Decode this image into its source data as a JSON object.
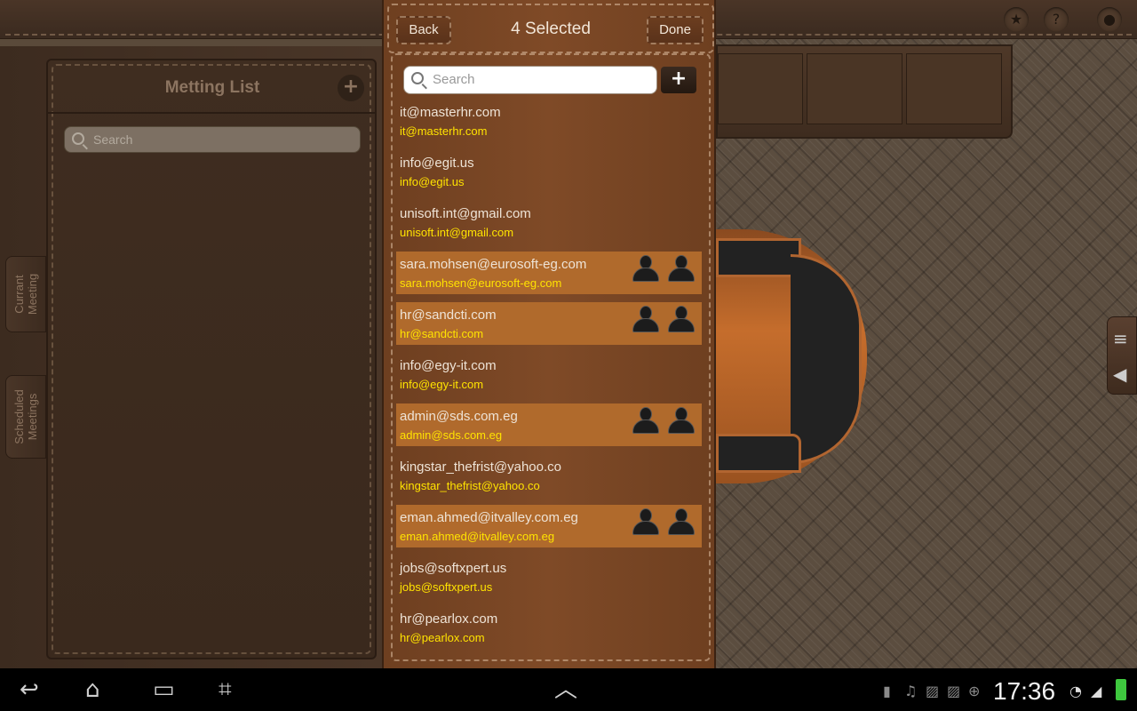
{
  "popup": {
    "title": "4 Selected",
    "back_label": "Back",
    "done_label": "Done",
    "search_placeholder": "Search",
    "add_label": "+",
    "contacts": [
      {
        "name": "it@masterhr.com",
        "email": "it@masterhr.com",
        "selected": false
      },
      {
        "name": "info@egit.us",
        "email": "info@egit.us",
        "selected": false
      },
      {
        "name": "unisoft.int@gmail.com",
        "email": "unisoft.int@gmail.com",
        "selected": false
      },
      {
        "name": "sara.mohsen@eurosoft-eg.com",
        "email": "sara.mohsen@eurosoft-eg.com",
        "selected": true
      },
      {
        "name": "hr@sandcti.com",
        "email": "hr@sandcti.com",
        "selected": true
      },
      {
        "name": "info@egy-it.com",
        "email": "info@egy-it.com",
        "selected": false
      },
      {
        "name": "admin@sds.com.eg",
        "email": "admin@sds.com.eg",
        "selected": true
      },
      {
        "name": "kingstar_thefrist@yahoo.co",
        "email": "kingstar_thefrist@yahoo.co",
        "selected": false
      },
      {
        "name": "eman.ahmed@itvalley.com.eg",
        "email": "eman.ahmed@itvalley.com.eg",
        "selected": true
      },
      {
        "name": "jobs@softxpert.us",
        "email": "jobs@softxpert.us",
        "selected": false
      },
      {
        "name": "hr@pearlox.com",
        "email": "hr@pearlox.com",
        "selected": false
      }
    ]
  },
  "left_panel": {
    "title": "Metting List",
    "add_label": "+",
    "search_placeholder": "Search"
  },
  "side_tabs": {
    "current": "Currant\nMeeting",
    "scheduled": "Scheduled\nMeetings"
  },
  "top_icons": [
    "star-icon",
    "help-icon",
    "user-icon"
  ],
  "right_tab_icons": [
    "menu-icon",
    "back-arrow-icon"
  ],
  "status_bar": {
    "time": "17:36"
  },
  "colors": {
    "selected_row": "#b06a2c",
    "email_text": "#ffe300",
    "popup_bg": "#7f4a27"
  }
}
